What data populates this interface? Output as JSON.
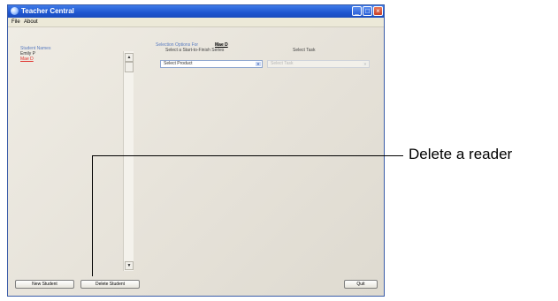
{
  "window": {
    "title": "Teacher Central"
  },
  "menu": {
    "items": [
      "File",
      "About"
    ]
  },
  "students": {
    "header": "Student Names",
    "list": [
      {
        "name": "Emily P",
        "selected": false
      },
      {
        "name": "Mae D",
        "selected": true
      }
    ]
  },
  "selection": {
    "header": "Selection Options For",
    "student_name": "Mae D",
    "series_label": "Select a Start-to-Finish Series",
    "task_label": "Select Task",
    "product_value": "Select Product",
    "task_value": "Select Task"
  },
  "buttons": {
    "new_student": "New Student",
    "delete_student": "Delete Student",
    "quit": "Quit"
  },
  "callout": {
    "text": "Delete a reader"
  },
  "colors": {
    "title_bar": "#1e56d0",
    "label_blue": "#5a7cc0",
    "selected_student": "#e0302a"
  }
}
